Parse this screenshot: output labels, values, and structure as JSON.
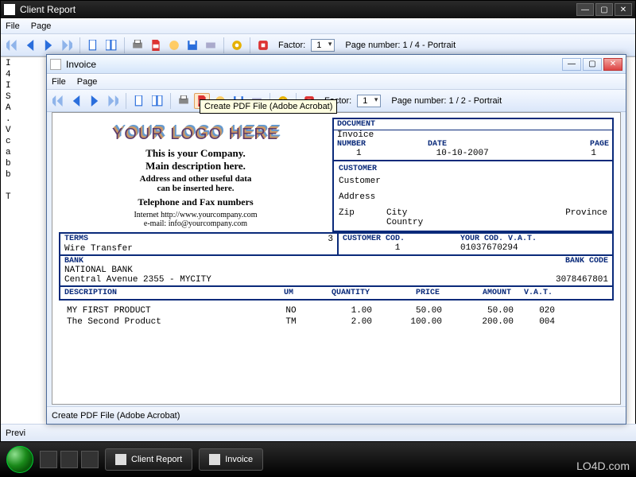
{
  "outer": {
    "title": "Client Report",
    "menu": {
      "file": "File",
      "page": "Page"
    },
    "factor_label": "Factor:",
    "factor_value": "1",
    "page_info": "Page number: 1 / 4 - Portrait",
    "status": "Previ",
    "left_text": "I\n4\nI\nS\nA\n.\nV\nc\na\nb\nb\n\nT"
  },
  "inner": {
    "title": "Invoice",
    "menu": {
      "file": "File",
      "page": "Page"
    },
    "factor_label": "Factor:",
    "factor_value": "1",
    "page_info": "Page number: 1 / 2 - Portrait",
    "tooltip": "Create PDF File (Adobe Acrobat)",
    "status": "Create PDF File (Adobe Acrobat)"
  },
  "doc": {
    "logo": "YOUR LOGO HERE",
    "company_line1": "This is your Company.",
    "company_line2": "Main description here.",
    "addr_line1": "Address and other useful data",
    "addr_line2": "can be inserted here.",
    "tel_line": "Telephone and Fax numbers",
    "web_line": "Internet http://www.yourcompany.com",
    "email_line": "e-mail: info@yourcompany.com",
    "hdr_document": "DOCUMENT",
    "doc_type": "Invoice",
    "lbl_number": "NUMBER",
    "number": "1",
    "lbl_date": "DATE",
    "date": "10-10-2007",
    "lbl_page": "PAGE",
    "page": "1",
    "hdr_customer": "CUSTOMER",
    "customer": "Customer",
    "address": "Address",
    "zip": "Zip",
    "city": "City",
    "country": "Country",
    "province": "Province",
    "lbl_terms": "TERMS",
    "terms": "Wire Transfer",
    "terms_num": "3",
    "lbl_custcod": "CUSTOMER COD.",
    "custcod": "1",
    "lbl_vat": "YOUR COD. V.A.T.",
    "vat": "01037670294",
    "lbl_bank": "BANK",
    "lbl_bankcode": "BANK CODE",
    "bank_name": "NATIONAL BANK",
    "bank_addr": "Central Avenue 2355 - MYCITY",
    "bank_code": "3078467801",
    "col_desc": "DESCRIPTION",
    "col_um": "UM",
    "col_qty": "QUANTITY",
    "col_price": "PRICE",
    "col_amt": "AMOUNT",
    "col_vat": "V.A.T.",
    "items": [
      {
        "desc": "MY FIRST PRODUCT",
        "um": "NO",
        "qty": "1.00",
        "price": "50.00",
        "amt": "50.00",
        "vat": "020"
      },
      {
        "desc": "The Second Product",
        "um": "TM",
        "qty": "2.00",
        "price": "100.00",
        "amt": "200.00",
        "vat": "004"
      }
    ]
  },
  "taskbar": {
    "btn1": "Client Report",
    "btn2": "Invoice"
  },
  "watermark": "LO4D.com"
}
